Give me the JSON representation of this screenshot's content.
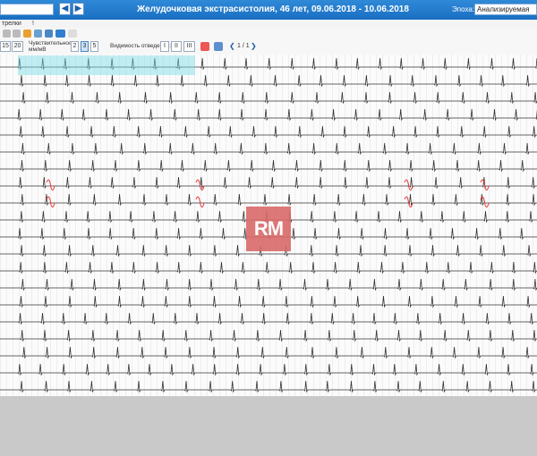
{
  "window": {
    "title": "Желудочковая экстрасистолия, 46 лет, 09.06.2018 - 10.06.2018",
    "search_value": "",
    "back_icon": "chevron-left-icon",
    "forward_icon": "chevron-right-icon"
  },
  "epoch": {
    "label": "Эпоха:",
    "value": "Анализируемая"
  },
  "menu": {
    "items": [
      "трелки",
      "!"
    ]
  },
  "toolbar": {
    "speed_options": [
      "15",
      "20"
    ],
    "sensitivity_label_line1": "Чувствительность,",
    "sensitivity_label_line2": "мм/мВ",
    "sensitivity_options": [
      "2",
      "3",
      "5"
    ],
    "sensitivity_selected": "3",
    "leads_label": "Видимость отведений:",
    "leads_options": [
      "I",
      "II",
      "III"
    ],
    "page_indicator": "1 / 1",
    "icons": [
      "undo-icon",
      "redo-icon",
      "marker-icon",
      "print-icon",
      "settings-icon",
      "screen-icon",
      "wall-icon"
    ]
  },
  "watermark": {
    "text": "RM",
    "color": "#d96a6a"
  },
  "colors": {
    "titlebar": "#1a6ec2",
    "selection": "#78dce6",
    "ecg_trace": "#333333",
    "ectopic_beat": "#e83b3b"
  },
  "ecg": {
    "rows": 20,
    "ectopic_rows": [
      7,
      8
    ],
    "ectopic_beats_x": [
      55,
      222,
      455,
      540
    ]
  }
}
